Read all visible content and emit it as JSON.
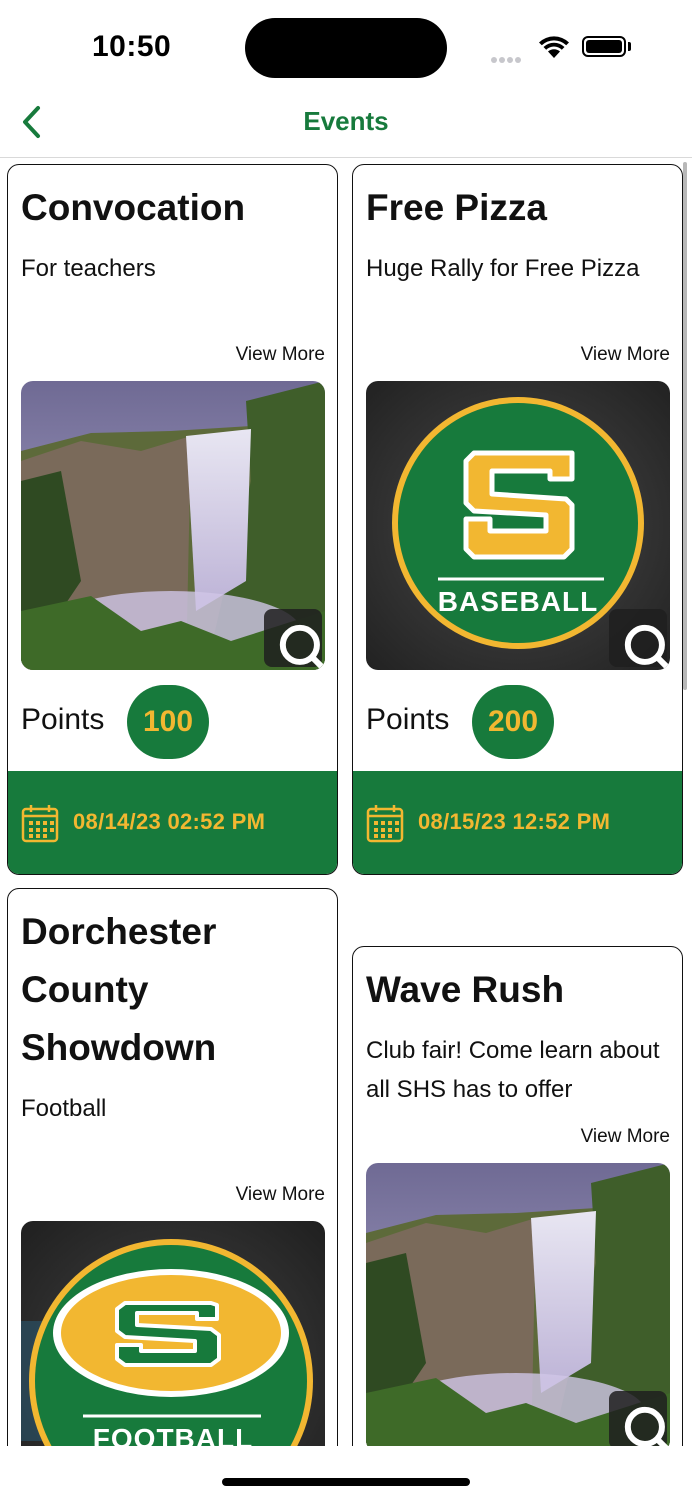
{
  "status_bar": {
    "time": "10:50"
  },
  "nav": {
    "title": "Events",
    "back_icon": "chevron-left-icon"
  },
  "events": [
    {
      "title": "Convocation",
      "description": "For teachers",
      "view_more": "View More",
      "image": "waterfall-photo",
      "points_label": "Points",
      "points": "100",
      "date": "08/14/23 02:52 PM"
    },
    {
      "title": "Free Pizza",
      "description": "Huge Rally for Free Pizza",
      "view_more": "View More",
      "image": "baseball-logo",
      "image_text": "BASEBALL",
      "points_label": "Points",
      "points": "200",
      "date": "08/15/23 12:52 PM"
    },
    {
      "title": "Dorchester County Showdown",
      "description": "Football",
      "view_more": "View More",
      "image": "football-logo",
      "image_text": "FOOTBALL"
    },
    {
      "title": "Wave Rush",
      "description": "Club fair!  Come learn about all SHS has to offer",
      "view_more": "View More",
      "image": "waterfall-photo"
    }
  ],
  "colors": {
    "brand_green": "#177a3c",
    "brand_gold": "#f2b731"
  }
}
